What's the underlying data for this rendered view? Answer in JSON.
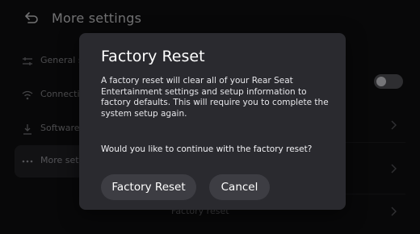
{
  "header": {
    "title": "More settings",
    "back_icon": "back-arrow-icon"
  },
  "sidebar": {
    "items": [
      {
        "label": "General settings",
        "icon": "sliders-icon"
      },
      {
        "label": "Connections",
        "icon": "wifi-icon"
      },
      {
        "label": "Software",
        "icon": "download-icon"
      },
      {
        "label": "More settings",
        "icon": "more-dots-icon",
        "selected": true
      }
    ]
  },
  "content": {
    "rows": [
      {
        "label": "Factory reset"
      }
    ],
    "toggle_state": "off"
  },
  "dialog": {
    "title": "Factory Reset",
    "body": "A factory reset will clear all of your Rear Seat Entertainment settings and setup information to factory defaults. This will require you to complete the system setup again.",
    "question": "Would you like to continue with the factory reset?",
    "confirm_label": "Factory Reset",
    "cancel_label": "Cancel"
  },
  "colors": {
    "background": "#0f0f11",
    "dialog": "#2a2a2f",
    "button": "#3d3d43",
    "selected_item": "#222226"
  }
}
